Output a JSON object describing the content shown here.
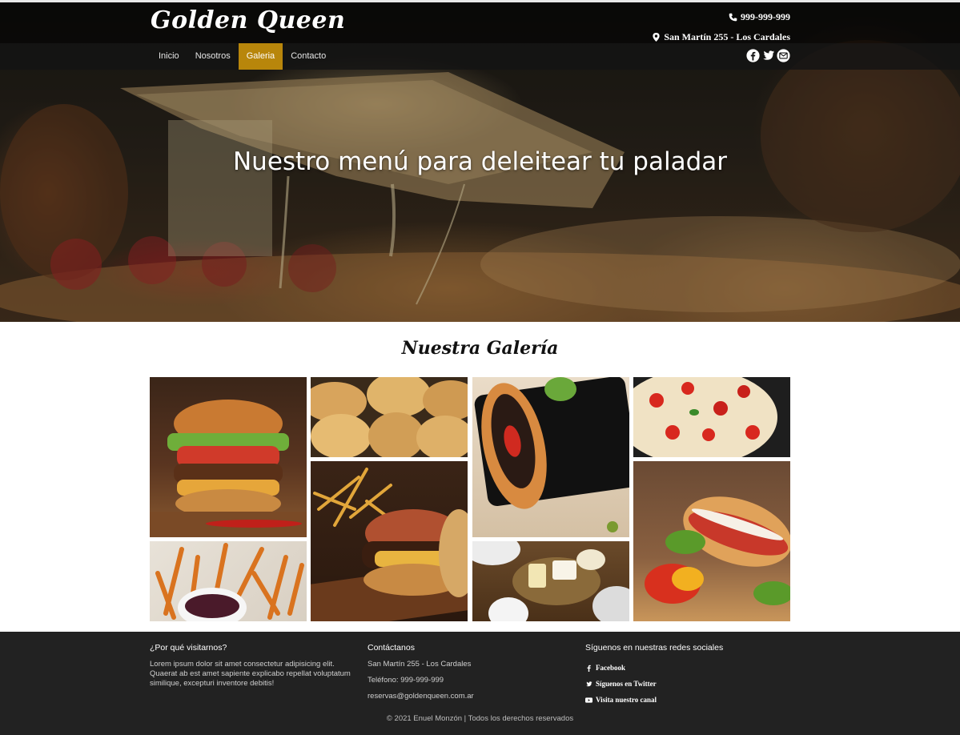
{
  "brand": {
    "logo": "Golden Queen"
  },
  "header": {
    "phone": "999-999-999",
    "address": "San Martín 255 - Los Cardales",
    "social_icons": [
      "facebook-icon",
      "twitter-icon",
      "email-icon"
    ]
  },
  "nav": {
    "items": [
      {
        "label": "Inicio",
        "active": false
      },
      {
        "label": "Nosotros",
        "active": false
      },
      {
        "label": "Galeria",
        "active": true
      },
      {
        "label": "Contacto",
        "active": false
      }
    ]
  },
  "hero": {
    "title": "Nuestro menú para deleitear tu paladar"
  },
  "gallery": {
    "title": "Nuestra Galería",
    "images": [
      "burger",
      "empanadas",
      "hot-dog",
      "pizza",
      "fries",
      "bacon-burger",
      "sandwich",
      "cheese-board"
    ]
  },
  "footer": {
    "why": {
      "heading": "¿Por qué visitarnos?",
      "text": "Lorem ipsum dolor sit amet consectetur adipisicing elit. Quaerat ab est amet sapiente explicabo repellat voluptatum similique, excepturi inventore debitis!"
    },
    "contact": {
      "heading": "Contáctanos",
      "address": "San Martín 255 - Los Cardales",
      "phone": "Teléfono: 999-999-999",
      "email": "reservas@goldenqueen.com.ar"
    },
    "social": {
      "heading": "Síguenos en nuestras redes sociales",
      "facebook": "Facebook",
      "twitter": "Síguenos en Twitter",
      "youtube": "Visita nuestro canal"
    },
    "copyright": "© 2021 Enuel Monzón | Todos los derechos reservados"
  },
  "colors": {
    "accent": "#b8860b",
    "footer_bg": "#222222",
    "nav_bg": "#141414"
  }
}
